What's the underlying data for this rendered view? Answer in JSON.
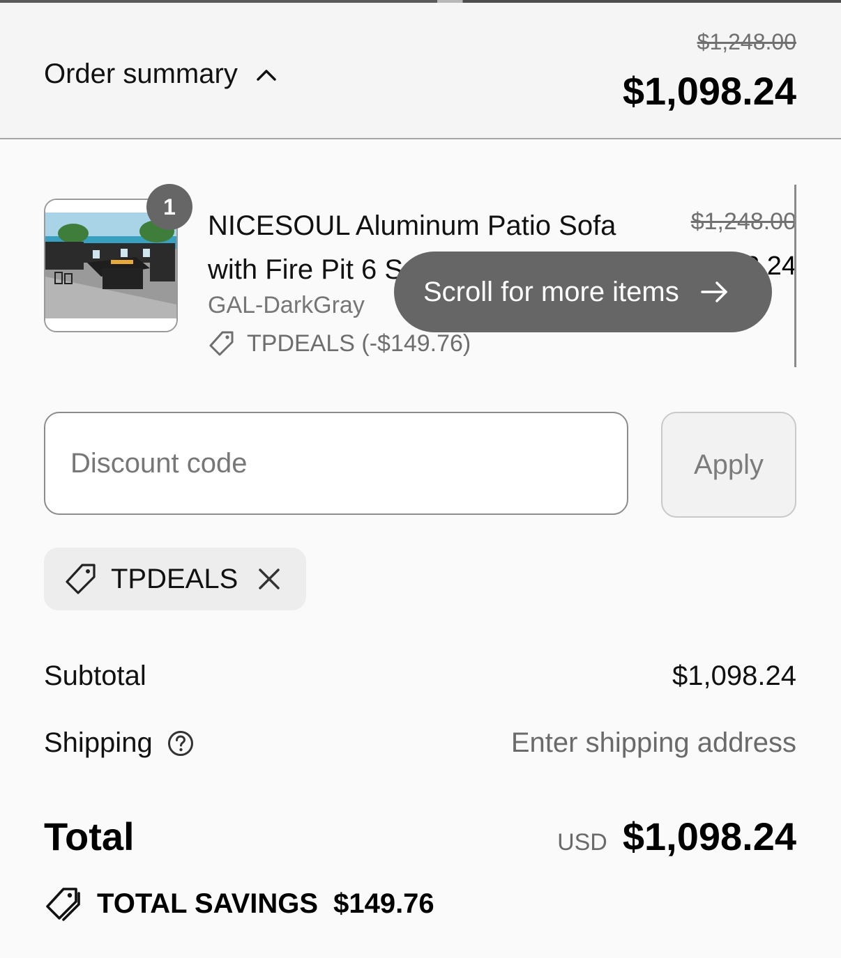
{
  "header": {
    "order_summary_label": "Order summary",
    "original_price": "$1,248.00",
    "price": "$1,098.24"
  },
  "item": {
    "quantity": "1",
    "name": "NICESOUL Aluminum Patio Sofa with Fire Pit 6 Seats",
    "variant": "GAL-DarkGray",
    "discount": "TPDEALS (-$149.76)",
    "original_price": "$1,248.00",
    "price": "$1,098.24",
    "image_alt": "Patio sofa with fire pit product photo"
  },
  "scroll_hint": {
    "label": "Scroll for more items"
  },
  "discount_form": {
    "placeholder": "Discount code",
    "apply_label": "Apply"
  },
  "applied_code": {
    "label": "TPDEALS"
  },
  "summary": {
    "subtotal_label": "Subtotal",
    "subtotal_value": "$1,098.24",
    "shipping_label": "Shipping",
    "shipping_value": "Enter shipping address",
    "total_label": "Total",
    "currency": "USD",
    "total_value": "$1,098.24",
    "savings_label": "TOTAL SAVINGS",
    "savings_value": "$149.76"
  }
}
